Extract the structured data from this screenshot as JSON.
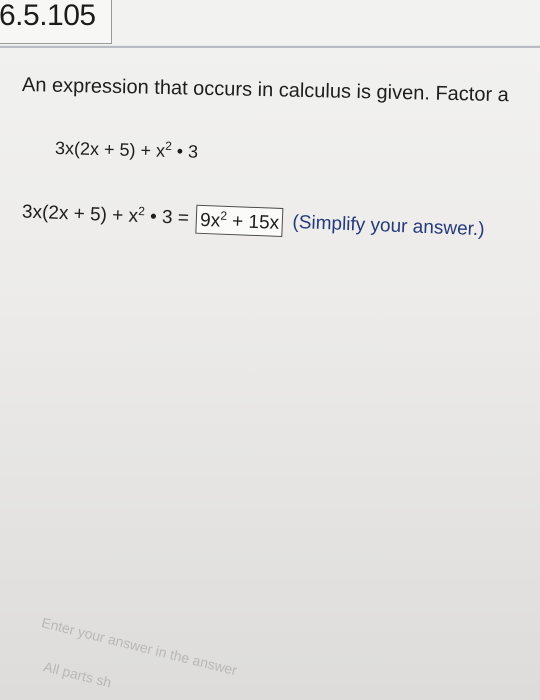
{
  "header": {
    "problem_number": "6.5.105"
  },
  "question": {
    "prompt": "An expression that occurs in calculus is given. Factor a",
    "given_expression": {
      "pre": "3x(2x + 5) + x",
      "exp": "2",
      "post": " • 3"
    },
    "answer_row": {
      "lhs_pre": "3x(2x + 5) + x",
      "lhs_exp": "2",
      "lhs_post": " • 3 =",
      "answer_pre": "9x",
      "answer_exp": "2",
      "answer_post": " + 15x",
      "hint": "(Simplify your answer.)"
    }
  },
  "footer": {
    "line1": "Enter your answer in the answer",
    "line2": "All parts sh"
  }
}
